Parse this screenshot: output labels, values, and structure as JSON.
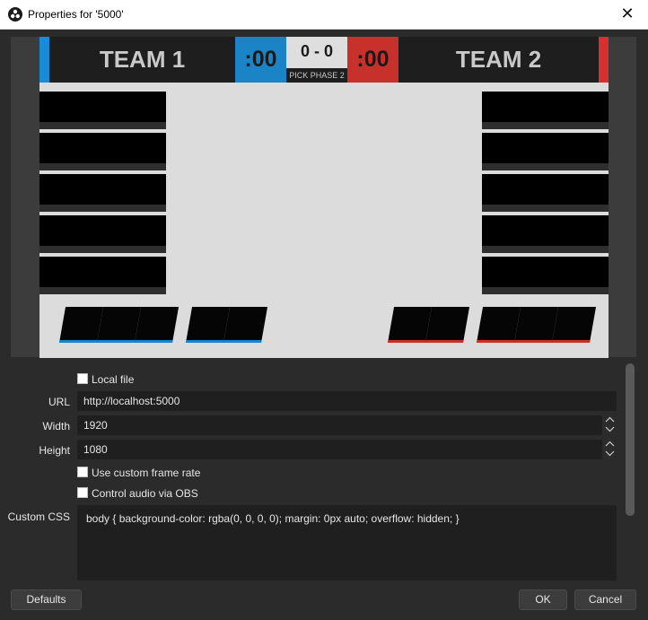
{
  "window": {
    "title": "Properties for '5000'",
    "close_glyph": "✕",
    "app_icon": "obs-logo-icon"
  },
  "preview": {
    "team1": "TEAM 1",
    "team2": "TEAM 2",
    "timer_left": ":00",
    "timer_right": ":00",
    "score": "0 - 0",
    "phase": "PICK PHASE 2",
    "colors": {
      "blue": "#1a84c7",
      "red": "#c8302c",
      "bar": "#1e1e1e",
      "bg": "#dcdcdc"
    }
  },
  "form": {
    "local_file": {
      "label": "Local file",
      "checked": false
    },
    "url": {
      "label": "URL",
      "value": "http://localhost:5000"
    },
    "width": {
      "label": "Width",
      "value": "1920"
    },
    "height": {
      "label": "Height",
      "value": "1080"
    },
    "custom_frame_rate": {
      "label": "Use custom frame rate",
      "checked": false
    },
    "control_audio": {
      "label": "Control audio via OBS",
      "checked": false
    },
    "custom_css": {
      "label": "Custom CSS",
      "value": "body { background-color: rgba(0, 0, 0, 0); margin: 0px auto; overflow: hidden; }"
    }
  },
  "buttons": {
    "defaults": "Defaults",
    "ok": "OK",
    "cancel": "Cancel"
  }
}
